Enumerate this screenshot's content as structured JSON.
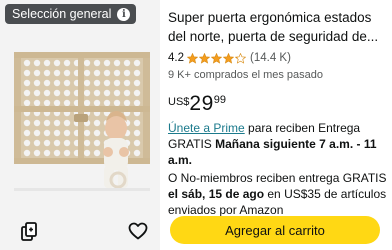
{
  "badge": {
    "label": "Selección general",
    "icon": "info-icon"
  },
  "product": {
    "title_line1": "Super puerta ergonómica estados",
    "title_line2": "del norte, puerta de seguridad de...",
    "rating": "4.2",
    "rating_value": 4.2,
    "rating_count": "(14.4 K)",
    "bought": "9 K+ comprados el mes pasado",
    "price_currency": "US$",
    "price_whole": "29",
    "price_fraction": "99"
  },
  "delivery": {
    "prime_link": "Únete a Prime",
    "prime_text": " para reciben Entrega GRATIS ",
    "prime_bold": "Mañana siguiente 7 a.m. - 11 a.m.",
    "nonmember_pre": "O No-miembros reciben entrega GRATIS ",
    "nonmember_bold": "el sáb, 15 de ago",
    "nonmember_post": " en US$35 de artículos enviados por Amazon"
  },
  "actions": {
    "cart_label": "Agregar al carrito",
    "compare_icon": "compare-icon",
    "wishlist_icon": "heart-icon"
  },
  "colors": {
    "button": "#ffd814",
    "star": "#f49d1f",
    "link": "#1b7a8c",
    "badge_bg": "#4a4d50"
  }
}
